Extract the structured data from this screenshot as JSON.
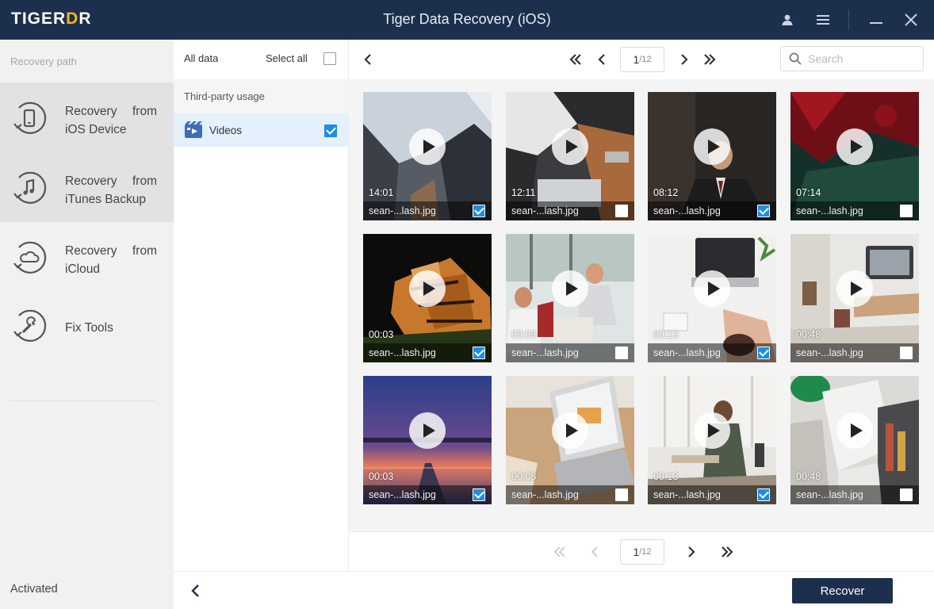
{
  "titlebar": {
    "logo_prefix": "TIGER",
    "logo_accent": "D",
    "logo_suffix": "R",
    "title": "Tiger Data Recovery (iOS)",
    "icons": [
      "user-icon",
      "menu-icon",
      "minimize-icon",
      "close-icon"
    ]
  },
  "sidebar": {
    "header": "Recovery path",
    "items": [
      {
        "label": "Recovery from iOS Device",
        "icon": "phone-recovery-icon",
        "active": true
      },
      {
        "label": "Recovery from iTunes Backup",
        "icon": "itunes-recovery-icon",
        "active": false
      },
      {
        "label": "Recovery from iCloud",
        "icon": "icloud-recovery-icon",
        "active": false
      },
      {
        "label": "Fix Tools",
        "icon": "wrench-icon",
        "active": false
      }
    ],
    "status": "Activated"
  },
  "categories": {
    "all_data": "All data",
    "select_all": "Select all",
    "select_all_checked": false,
    "section": "Third-party usage",
    "items": [
      {
        "label": "Videos",
        "icon": "video-clip-icon",
        "checked": true
      }
    ]
  },
  "toolbar": {
    "page_current": "1",
    "page_total": "/12",
    "search_placeholder": "Search"
  },
  "files": [
    {
      "duration": "14:01",
      "name": "sean-...lash.jpg",
      "checked": true
    },
    {
      "duration": "12:11",
      "name": "sean-...lash.jpg",
      "checked": false
    },
    {
      "duration": "08:12",
      "name": "sean-...lash.jpg",
      "checked": true
    },
    {
      "duration": "07:14",
      "name": "sean-...lash.jpg",
      "checked": false
    },
    {
      "duration": "00:03",
      "name": "sean-...lash.jpg",
      "checked": true
    },
    {
      "duration": "00:08",
      "name": "sean-...lash.jpg",
      "checked": false
    },
    {
      "duration": "00:13",
      "name": "sean-...lash.jpg",
      "checked": true
    },
    {
      "duration": "00:48",
      "name": "sean-...lash.jpg",
      "checked": false
    },
    {
      "duration": "00:03",
      "name": "sean-...lash.jpg",
      "checked": true
    },
    {
      "duration": "00:08",
      "name": "sean-...lash.jpg",
      "checked": false
    },
    {
      "duration": "00:13",
      "name": "sean-...lash.jpg",
      "checked": true
    },
    {
      "duration": "00:48",
      "name": "sean-...lash.jpg",
      "checked": false
    }
  ],
  "footer": {
    "recover_label": "Recover"
  },
  "colors": {
    "titlebar_bg": "#1c2f4d",
    "accent": "#f3b51c",
    "checkbox": "#1e8de6",
    "selected_row": "#e4f0fc"
  }
}
